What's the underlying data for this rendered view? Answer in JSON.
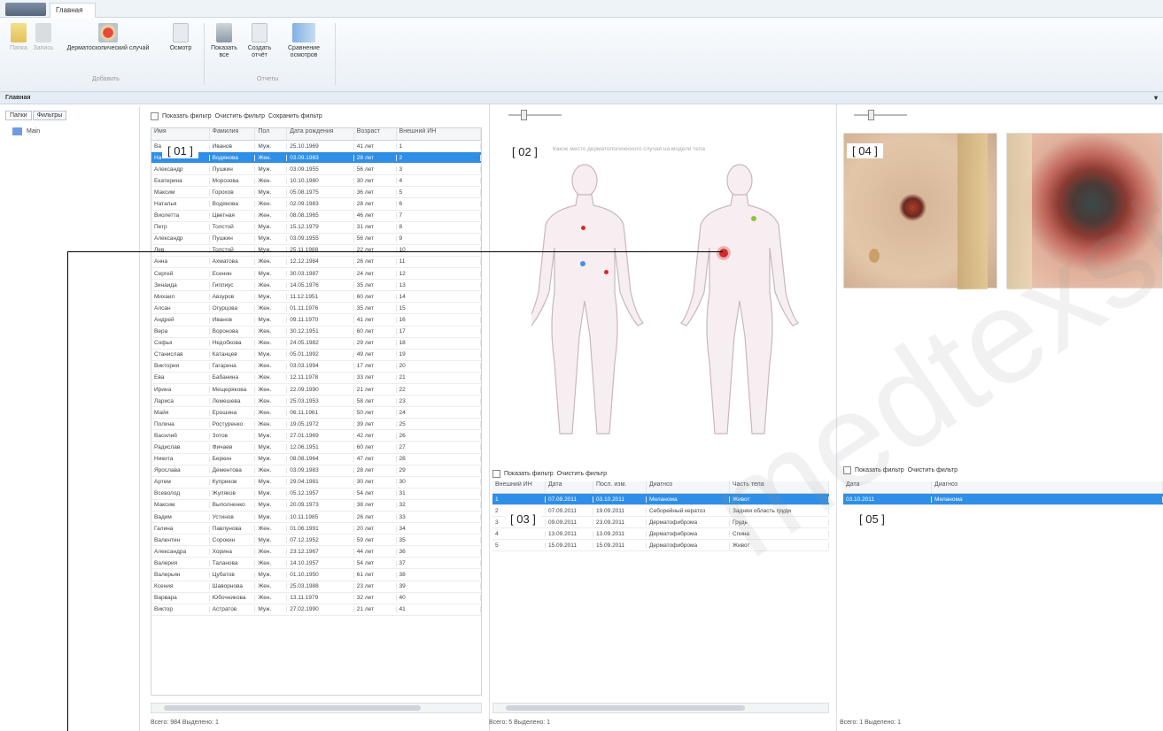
{
  "window": {
    "tab_file": "",
    "tab_home": "Главная",
    "ribbon_title": "Главная",
    "pin_icon": "pin-icon"
  },
  "ribbon": {
    "group_add_label": "Добавить",
    "group_reports_label": "Отчеты",
    "buttons": [
      {
        "label": "Папка",
        "icon": "folder-icon",
        "disabled": true
      },
      {
        "label": "Запись",
        "icon": "record-icon",
        "disabled": true
      },
      {
        "label": "Дерматоскопический случай",
        "icon": "dermatoscopy-icon",
        "disabled": false
      },
      {
        "label": "Осмотр",
        "icon": "exam-icon",
        "disabled": false
      },
      {
        "label": "Показать все",
        "icon": "show-all-icon",
        "disabled": false
      },
      {
        "label": "Создать отчёт",
        "icon": "report-icon",
        "disabled": false
      },
      {
        "label": "Сравнение осмотров",
        "icon": "compare-icon",
        "disabled": false
      }
    ]
  },
  "left": {
    "tab_folders": "Папки",
    "tab_filters": "Фильтры",
    "tree_item": "Main"
  },
  "patients": {
    "show_filter": "Показать фильтр",
    "clear_filter": "Очистить фильтр",
    "save_filter": "Сохранить фильтр",
    "columns": [
      "Имя",
      "Фамилия",
      "Пол",
      "Дата рождения",
      "Возраст",
      "Внешний ИН"
    ],
    "status": "Всего: 984   Выделено: 1",
    "rows": [
      [
        "Ва",
        "Иванов",
        "Муж.",
        "25.10.1969",
        "41 лет",
        "1"
      ],
      [
        "На",
        "Водянова",
        "Жен.",
        "03.09.1983",
        "28 лет",
        "2"
      ],
      [
        "Александр",
        "Пушкин",
        "Муж.",
        "03.09.1955",
        "56 лет",
        "3"
      ],
      [
        "Екатерина",
        "Морозова",
        "Жен.",
        "10.10.1980",
        "30 лет",
        "4"
      ],
      [
        "Максим",
        "Горохов",
        "Муж.",
        "05.08.1975",
        "36 лет",
        "5"
      ],
      [
        "Наталья",
        "Водянова",
        "Жен.",
        "02.09.1983",
        "28 лет",
        "6"
      ],
      [
        "Виолетта",
        "Цветная",
        "Жен.",
        "08.08.1965",
        "46 лет",
        "7"
      ],
      [
        "Петр",
        "Толстой",
        "Муж.",
        "15.12.1979",
        "31 лет",
        "8"
      ],
      [
        "Александр",
        "Пушкин",
        "Муж.",
        "03.09.1955",
        "56 лет",
        "9"
      ],
      [
        "Лев",
        "Толстой",
        "Муж.",
        "25.11.1988",
        "22 лет",
        "10"
      ],
      [
        "Анна",
        "Ахматова",
        "Жен.",
        "12.12.1984",
        "26 лет",
        "11"
      ],
      [
        "Сергей",
        "Есенин",
        "Муж.",
        "30.03.1987",
        "24 лет",
        "12"
      ],
      [
        "Зинаида",
        "Гиппиус",
        "Жен.",
        "14.05.1976",
        "35 лет",
        "13"
      ],
      [
        "Михаил",
        "Авзуров",
        "Муж.",
        "11.12.1951",
        "60 лет",
        "14"
      ],
      [
        "Алсан",
        "Огурцова",
        "Жен.",
        "01.11.1976",
        "35 лет",
        "15"
      ],
      [
        "Андрей",
        "Иванов",
        "Муж.",
        "09.11.1970",
        "41 лет",
        "16"
      ],
      [
        "Вера",
        "Воронова",
        "Жен.",
        "30.12.1951",
        "60 лет",
        "17"
      ],
      [
        "Софья",
        "Недобкова",
        "Жен.",
        "24.05.1982",
        "29 лет",
        "18"
      ],
      [
        "Станислав",
        "Катанцев",
        "Муж.",
        "05.01.1992",
        "49 лет",
        "19"
      ],
      [
        "Виктория",
        "Гагарина",
        "Жен.",
        "03.03.1994",
        "17 лет",
        "20"
      ],
      [
        "Ева",
        "Бабанина",
        "Жен.",
        "12.11.1978",
        "33 лет",
        "21"
      ],
      [
        "Ирина",
        "Мещерякова",
        "Жен.",
        "22.09.1990",
        "21 лет",
        "22"
      ],
      [
        "Лариса",
        "Лемешева",
        "Жен.",
        "25.03.1953",
        "58 лет",
        "23"
      ],
      [
        "Майя",
        "Ерошина",
        "Жен.",
        "06.11.1961",
        "50 лет",
        "24"
      ],
      [
        "Полина",
        "Ростуренко",
        "Жен.",
        "19.05.1972",
        "39 лет",
        "25"
      ],
      [
        "Василий",
        "Зотов",
        "Муж.",
        "27.01.1969",
        "42 лет",
        "26"
      ],
      [
        "Радислав",
        "Фичаев",
        "Муж.",
        "12.06.1951",
        "60 лет",
        "27"
      ],
      [
        "Никита",
        "Беркин",
        "Муж.",
        "08.08.1964",
        "47 лет",
        "28"
      ],
      [
        "Ярослава",
        "Дементова",
        "Жен.",
        "03.09.1983",
        "28 лет",
        "29"
      ],
      [
        "Артем",
        "Куприков",
        "Муж.",
        "29.04.1981",
        "30 лет",
        "30"
      ],
      [
        "Всеволод",
        "Жуляков",
        "Муж.",
        "05.12.1957",
        "54 лет",
        "31"
      ],
      [
        "Максим",
        "Выполненко",
        "Муж.",
        "20.09.1973",
        "38 лет",
        "32"
      ],
      [
        "Вадим",
        "Устинов",
        "Муж.",
        "10.11.1985",
        "26 лет",
        "33"
      ],
      [
        "Галина",
        "Павлунова",
        "Жен.",
        "01.06.1991",
        "20 лет",
        "34"
      ],
      [
        "Валентин",
        "Сорокин",
        "Муж.",
        "07.12.1952",
        "59 лет",
        "35"
      ],
      [
        "Александра",
        "Хорина",
        "Жен.",
        "23.12.1967",
        "44 лет",
        "36"
      ],
      [
        "Валерия",
        "Таланова",
        "Жен.",
        "14.10.1957",
        "54 лет",
        "37"
      ],
      [
        "Валерьян",
        "Цубатов",
        "Муж.",
        "01.10.1950",
        "61 лет",
        "38"
      ],
      [
        "Ксения",
        "Шаворнова",
        "Жен.",
        "25.03.1988",
        "23 лет",
        "39"
      ],
      [
        "Варвара",
        "Юбочникова",
        "Жен.",
        "13.11.1979",
        "32 лет",
        "40"
      ],
      [
        "Виктор",
        "Астратов",
        "Муж.",
        "27.02.1990",
        "21 лет",
        "41"
      ]
    ]
  },
  "body_map": {
    "hint": "Какое место дерматологического случая на модели тела"
  },
  "cases": {
    "show_filter": "Показать фильтр",
    "clear_filter": "Очистить фильтр",
    "columns": [
      "Внешний ИН",
      "Дата",
      "Посл. изм.",
      "Диагноз",
      "Часть тела"
    ],
    "status": "Всего: 5   Выделено: 1",
    "rows": [
      [
        "1",
        "07.09.2011",
        "03.10.2011",
        "Меланома",
        "Живот"
      ],
      [
        "2",
        "07.09.2011",
        "19.09.2011",
        "Себорейный кератоз",
        "Задняя область груди"
      ],
      [
        "3",
        "09.09.2011",
        "23.09.2011",
        "Дерматофиброма",
        "Грудь"
      ],
      [
        "4",
        "13.09.2011",
        "13.09.2011",
        "Дерматофиброма",
        "Спина"
      ],
      [
        "5",
        "15.09.2011",
        "15.09.2011",
        "Дерматофиброма",
        "Живот"
      ]
    ]
  },
  "exams": {
    "show_filter": "Показать фильтр",
    "clear_filter": "Очистить фильтр",
    "columns": [
      "Дата",
      "Диагноз"
    ],
    "status": "Всего: 1   Выделено: 1",
    "rows": [
      [
        "03.10.2011",
        "Меланома"
      ]
    ]
  },
  "markers": [
    "[ 01 ]",
    "[ 02 ]",
    "[ 03 ]",
    "[ 04 ]",
    "[ 05 ]"
  ],
  "watermark": "medtexst.ru",
  "colors": {
    "selection": "#2f8fe6",
    "lesion_red": "#d62a2a",
    "lesion_blue": "#4a8fe0",
    "lesion_green": "#8fc23a"
  }
}
